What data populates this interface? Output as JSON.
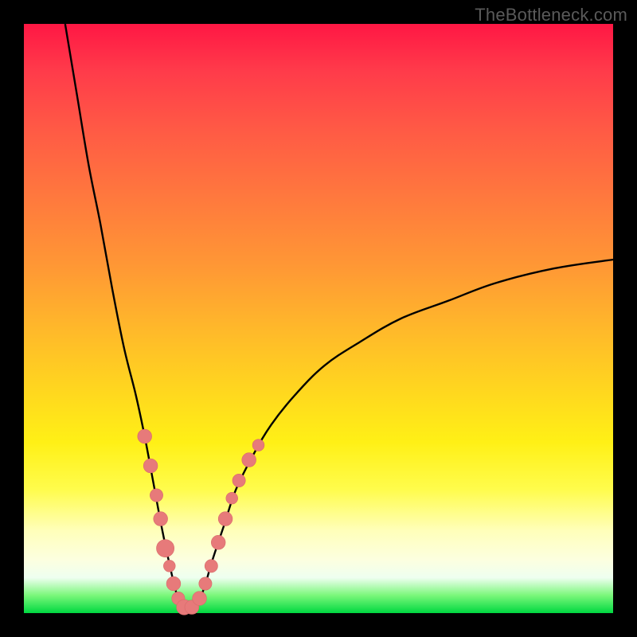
{
  "watermark": "TheBottleneck.com",
  "colors": {
    "frame": "#000000",
    "curve": "#000000",
    "dot_fill": "#e77a7a",
    "dot_stroke": "#d86a6a",
    "gradient_stops": [
      "#ff1744",
      "#ff7a3d",
      "#ffd61f",
      "#ffffba",
      "#00d840"
    ]
  },
  "chart_data": {
    "type": "line",
    "title": "",
    "xlabel": "",
    "ylabel": "",
    "xlim": [
      0,
      100
    ],
    "ylim": [
      0,
      100
    ],
    "grid": false,
    "curve_notes": "Two-branch V-shaped bottleneck curve, minimum near x≈27 at y≈0, left branch rises to 100 at x≈7, right branch rises to ≈60 at x=100.",
    "curve_left": [
      {
        "x": 7,
        "y": 100
      },
      {
        "x": 9,
        "y": 88
      },
      {
        "x": 11,
        "y": 76
      },
      {
        "x": 13,
        "y": 66
      },
      {
        "x": 15,
        "y": 55
      },
      {
        "x": 17,
        "y": 45
      },
      {
        "x": 19,
        "y": 37
      },
      {
        "x": 20.5,
        "y": 30
      },
      {
        "x": 22,
        "y": 22
      },
      {
        "x": 23.5,
        "y": 14
      },
      {
        "x": 25,
        "y": 7
      },
      {
        "x": 26,
        "y": 3
      },
      {
        "x": 27,
        "y": 0.5
      }
    ],
    "curve_right": [
      {
        "x": 29,
        "y": 0.5
      },
      {
        "x": 30.5,
        "y": 4
      },
      {
        "x": 32,
        "y": 9
      },
      {
        "x": 34,
        "y": 15
      },
      {
        "x": 36,
        "y": 21
      },
      {
        "x": 39,
        "y": 27
      },
      {
        "x": 42,
        "y": 32
      },
      {
        "x": 46,
        "y": 37
      },
      {
        "x": 51,
        "y": 42
      },
      {
        "x": 57,
        "y": 46
      },
      {
        "x": 64,
        "y": 50
      },
      {
        "x": 72,
        "y": 53
      },
      {
        "x": 80,
        "y": 56
      },
      {
        "x": 90,
        "y": 58.5
      },
      {
        "x": 100,
        "y": 60
      }
    ],
    "points": [
      {
        "x": 20.5,
        "y": 30,
        "r": 1.2
      },
      {
        "x": 21.5,
        "y": 25,
        "r": 1.2
      },
      {
        "x": 22.5,
        "y": 20,
        "r": 1.1
      },
      {
        "x": 23.2,
        "y": 16,
        "r": 1.2
      },
      {
        "x": 24.0,
        "y": 11,
        "r": 1.5
      },
      {
        "x": 24.7,
        "y": 8,
        "r": 1.0
      },
      {
        "x": 25.4,
        "y": 5,
        "r": 1.2
      },
      {
        "x": 26.2,
        "y": 2.5,
        "r": 1.1
      },
      {
        "x": 27.2,
        "y": 1.0,
        "r": 1.3
      },
      {
        "x": 28.5,
        "y": 1.0,
        "r": 1.2
      },
      {
        "x": 29.8,
        "y": 2.5,
        "r": 1.2
      },
      {
        "x": 30.8,
        "y": 5,
        "r": 1.1
      },
      {
        "x": 31.8,
        "y": 8,
        "r": 1.1
      },
      {
        "x": 33.0,
        "y": 12,
        "r": 1.2
      },
      {
        "x": 34.2,
        "y": 16,
        "r": 1.2
      },
      {
        "x": 35.3,
        "y": 19.5,
        "r": 1.0
      },
      {
        "x": 36.5,
        "y": 22.5,
        "r": 1.1
      },
      {
        "x": 38.2,
        "y": 26,
        "r": 1.2
      },
      {
        "x": 39.8,
        "y": 28.5,
        "r": 1.0
      }
    ]
  }
}
